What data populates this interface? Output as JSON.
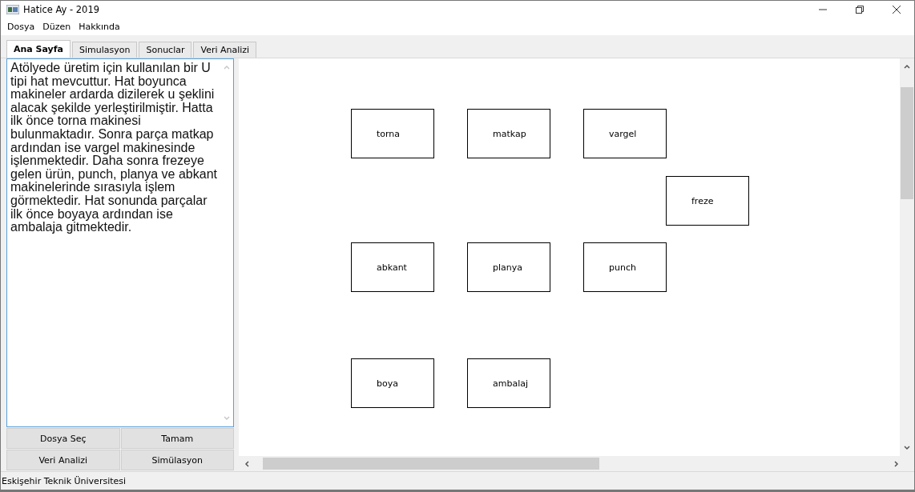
{
  "window": {
    "title": "Hatice Ay - 2019"
  },
  "menu": [
    "Dosya",
    "Düzen",
    "Hakkında"
  ],
  "tabs": [
    {
      "label": "Ana Sayfa",
      "selected": true
    },
    {
      "label": "Simulasyon",
      "selected": false
    },
    {
      "label": "Sonuclar",
      "selected": false
    },
    {
      "label": "Veri Analizi",
      "selected": false
    }
  ],
  "description": "Atölyede üretim için kullanılan bir U tipi hat mevcuttur. Hat boyunca makineler ardarda dizilerek u şeklini alacak şekilde yerleştirilmiştir. Hatta ilk önce torna makinesi bulunmaktadır. Sonra parça matkap ardından ise vargel makinesinde işlenmektedir. Daha sonra frezeye gelen ürün, punch, planya ve abkant makinelerinde sırasıyla işlem görmektedir. Hat sonunda parçalar ilk önce boyaya ardından ise ambalaja gitmektedir.",
  "buttons": [
    "Dosya Seç",
    "Tamam",
    "Veri Analizi",
    "Simülasyon"
  ],
  "machines": [
    "torna",
    "matkap",
    "vargel",
    "freze",
    "abkant",
    "planya",
    "punch",
    "boya",
    "ambalaj"
  ],
  "status_bar": "Eskişehir Teknik Üniversitesi"
}
